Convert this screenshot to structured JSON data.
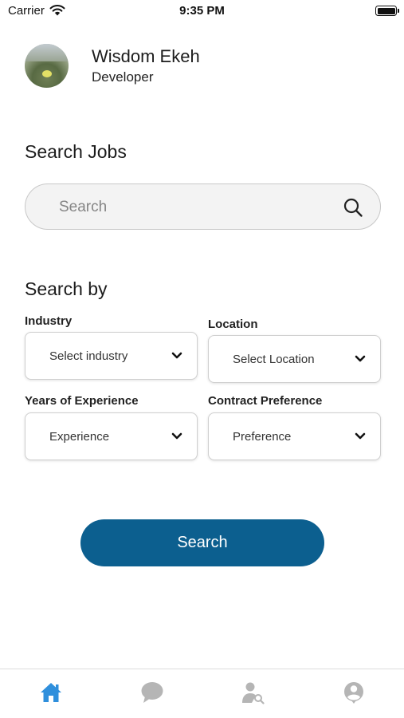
{
  "status_bar": {
    "carrier": "Carrier",
    "time": "9:35 PM"
  },
  "profile": {
    "name": "Wisdom Ekeh",
    "role": "Developer"
  },
  "search_section": {
    "title": "Search Jobs",
    "placeholder": "Search",
    "icon": "search-icon"
  },
  "filters": {
    "title": "Search by",
    "industry": {
      "label": "Industry",
      "value": "Select industry"
    },
    "location": {
      "label": "Location",
      "value": "Select Location"
    },
    "experience": {
      "label": "Years of Experience",
      "value": "Experience"
    },
    "contract": {
      "label": "Contract Preference",
      "value": "Preference"
    }
  },
  "search_button": {
    "label": "Search"
  },
  "tab_bar": {
    "items": [
      {
        "icon": "home-icon",
        "active": true
      },
      {
        "icon": "chat-bubble-icon",
        "active": false
      },
      {
        "icon": "user-search-icon",
        "active": false
      },
      {
        "icon": "profile-icon",
        "active": false
      }
    ]
  },
  "colors": {
    "primary": "#0c5f8f",
    "active_tab": "#2f8fdc",
    "inactive_tab": "#b5b5b5"
  }
}
